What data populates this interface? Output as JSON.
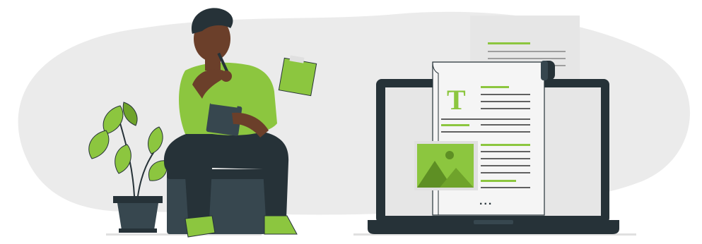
{
  "illustration": {
    "document_letter": "T",
    "document_more": "...",
    "colors": {
      "accent": "#8cc63f",
      "dark": "#263238",
      "background_blob": "#ebebeb",
      "skin": "#6b3f2a"
    },
    "icons": [
      "image-placeholder-icon",
      "text-icon"
    ]
  }
}
